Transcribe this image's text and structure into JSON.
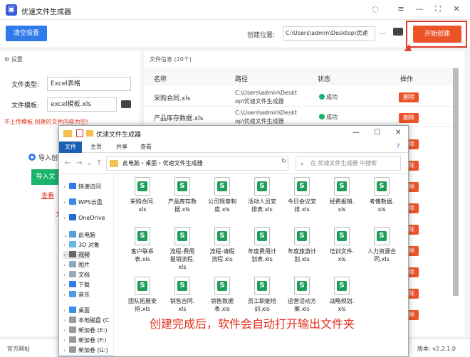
{
  "app": {
    "title": "优速文件生成器",
    "logo": "logo-icon"
  },
  "toolbar": {
    "clear_label": "清空设置",
    "location_label": "创建位置:",
    "location_value": "C:\\Users\\admin\\Desktop\\优速",
    "more": "...",
    "start_label": "开始创建"
  },
  "settings": {
    "header": "设置",
    "type_label": "文件类型:",
    "type_value": "Excel表格",
    "template_label": "文件模板:",
    "template_value": "excel模板.xls",
    "warning": "不上传模板,创建的文件内容为空!",
    "import_radio": "导入创",
    "import_button": "导入文",
    "view_link": "查看",
    "wen": "文"
  },
  "fileinfo": {
    "header": "文件信息 (20个)",
    "columns": [
      "名称",
      "路径",
      "状态",
      "操作"
    ],
    "rows": [
      {
        "name": "采购合同.xls",
        "path1": "C:\\Users\\admin\\Deskt",
        "path2": "op\\优速文件生成器",
        "status": "成功",
        "action": "删除"
      },
      {
        "name": "产品库存数据.xls",
        "path1": "C:\\Users\\admin\\Deskt",
        "path2": "op\\优速文件生成器",
        "status": "成功",
        "action": "删除"
      }
    ],
    "more_actions": [
      "删除",
      "删除",
      "删除",
      "删除",
      "删除",
      "删除",
      "删除",
      "删除",
      "删除",
      "删除"
    ]
  },
  "footer": {
    "left": "官方网址",
    "right": "版本: v2.2.1.0"
  },
  "explorer": {
    "title": "优速文件生成器",
    "tabs": [
      "文件",
      "主页",
      "共享",
      "查看"
    ],
    "breadcrumb": [
      "此电脑",
      "桌面",
      "优速文件生成器"
    ],
    "search_placeholder": "在 优速文件生成器 中搜索",
    "tree": [
      "快速访问",
      "WPS云盘",
      "OneDrive",
      "此电脑",
      "3D 对象",
      "视频",
      "图片",
      "文档",
      "下载",
      "音乐",
      "桌面",
      "本地磁盘 (C",
      "新加卷 (E:)",
      "新加卷 (F:)",
      "新加卷 (G:)"
    ],
    "files": [
      [
        "采购合同.",
        "xls"
      ],
      [
        "产品库存数",
        "据.xls"
      ],
      [
        "公司规章制",
        "度.xls"
      ],
      [
        "活动人员安",
        "排表.xls"
      ],
      [
        "今日会议安",
        "排.xls"
      ],
      [
        "经费报销.",
        "xls"
      ],
      [
        "考情数据.",
        "xls"
      ],
      [
        "客户联系",
        "表.xls"
      ],
      [
        "流程-费用",
        "报销流程.",
        "xls"
      ],
      [
        "流程-请假",
        "流程.xls"
      ],
      [
        "年度费用计",
        "划表.xls"
      ],
      [
        "年度旅游计",
        "划.xls"
      ],
      [
        "培训文件.",
        "xls"
      ],
      [
        "人力资源合",
        "同.xls"
      ],
      [
        "团队拓展安",
        "排.xls"
      ],
      [
        "销售合同.",
        "xls"
      ],
      [
        "销售数据",
        "表.xls"
      ],
      [
        "员工职能培",
        "训.xls"
      ],
      [
        "运营活动方",
        "案.xls"
      ],
      [
        "战略规划.",
        "xls"
      ]
    ]
  },
  "annotation": "创建完成后，软件会自动打开输出文件夹"
}
